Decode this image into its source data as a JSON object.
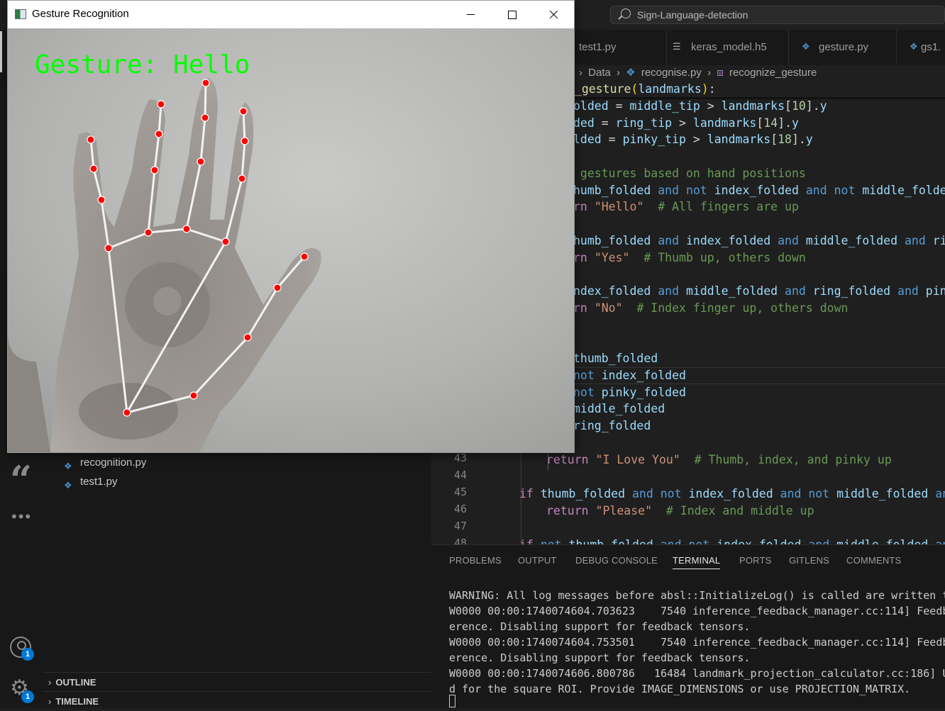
{
  "vscode": {
    "search_label": "Sign-Language-detection",
    "tabs": [
      "test1.py",
      "keras_model.h5",
      "gesture.py",
      "gs1."
    ],
    "breadcrumb": [
      "Data",
      "recognise.py",
      "recognize_gesture"
    ],
    "sidebar_files": [
      "recognition.py",
      "test1.py"
    ],
    "outline_label": "OUTLINE",
    "timeline_label": "TIMELINE",
    "account_badge": "1",
    "settings_badge": "1",
    "line_numbers": [
      "43",
      "44",
      "45",
      "46",
      "47",
      "48"
    ],
    "panel_tabs": [
      "PROBLEMS",
      "OUTPUT",
      "DEBUG CONSOLE",
      "TERMINAL",
      "PORTS",
      "GITLENS",
      "COMMENTS"
    ],
    "active_panel_tab": "TERMINAL",
    "terminal_lines": [
      "WARNING: All log messages before absl::InitializeLog() is called are written t",
      "W0000 00:00:1740074604.703623    7540 inference_feedback_manager.cc:114] Feedb",
      "erence. Disabling support for feedback tensors.",
      "W0000 00:00:1740074604.753501    7540 inference_feedback_manager.cc:114] Feedb",
      "erence. Disabling support for feedback tensors.",
      "W0000 00:00:1740074606.800786   16484 landmark_projection_calculator.cc:186] U",
      "d for the square ROI. Provide IMAGE_DIMENSIONS or use PROJECTION_MATRIX."
    ]
  },
  "cv_window": {
    "title": "Gesture Recognition",
    "overlay_text": "Gesture: Hello",
    "overlay_color": "#00ff00",
    "landmark_color": "#ff0000",
    "connection_color": "#f2f2f2"
  }
}
